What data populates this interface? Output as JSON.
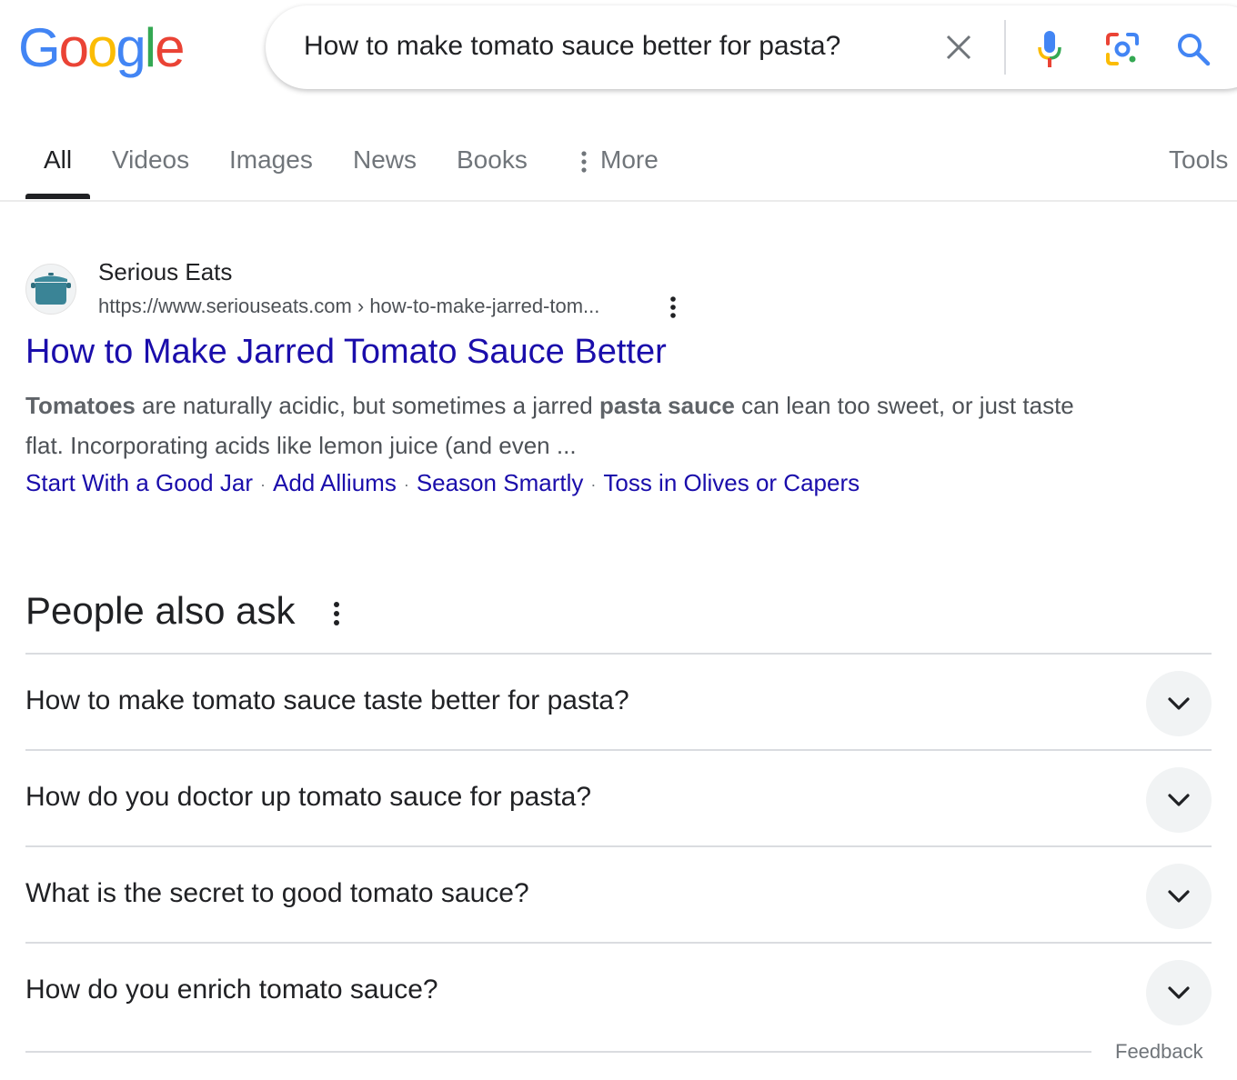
{
  "logo": {
    "letters": [
      "G",
      "o",
      "o",
      "g",
      "l",
      "e"
    ],
    "colors": [
      "#4285F4",
      "#EA4335",
      "#FBBC05",
      "#4285F4",
      "#34A853",
      "#EA4335"
    ]
  },
  "search": {
    "query": "How to make tomato sauce better for pasta?",
    "icons": [
      "close-icon",
      "microphone-icon",
      "camera-lens-icon",
      "search-icon"
    ]
  },
  "tabs": {
    "all": "All",
    "videos": "Videos",
    "images": "Images",
    "news": "News",
    "books": "Books",
    "more": "More",
    "tools": "Tools"
  },
  "result": {
    "site_name": "Serious Eats",
    "url": "https://www.seriouseats.com › how-to-make-jarred-tom...",
    "title": "How to Make Jarred Tomato Sauce Better",
    "snippet": {
      "b1": "Tomatoes",
      "t1": " are naturally acidic, but sometimes a jarred ",
      "b2": "pasta sauce",
      "t2": " can lean too sweet, or just taste flat. Incorporating acids like lemon juice (and even ..."
    },
    "sitelinks": [
      "Start With a Good Jar",
      "Add Alliums",
      "Season Smartly",
      "Toss in Olives or Capers"
    ],
    "separator": "·"
  },
  "people_also_ask": {
    "heading": "People also ask",
    "questions": [
      "How to make tomato sauce taste better for pasta?",
      "How do you doctor up tomato sauce for pasta?",
      "What is the secret to good tomato sauce?",
      "How do you enrich tomato sauce?"
    ],
    "feedback": "Feedback"
  },
  "colors": {
    "link": "#1a0dab",
    "text": "#202124",
    "muted": "#4d5156"
  }
}
